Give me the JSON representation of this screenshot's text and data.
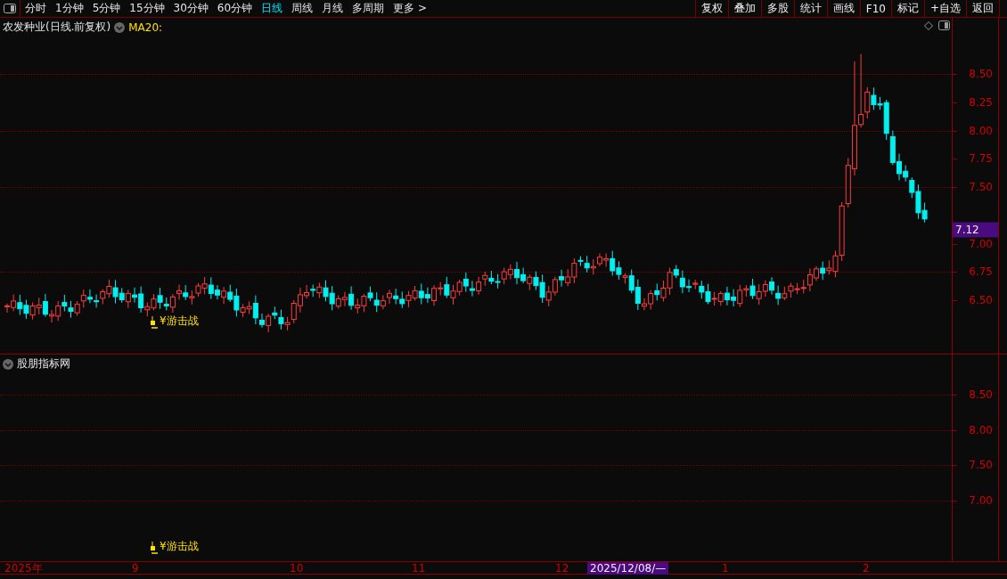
{
  "toolbar": {
    "periods": [
      {
        "label": "分时",
        "selected": false
      },
      {
        "label": "1分钟",
        "selected": false
      },
      {
        "label": "5分钟",
        "selected": false
      },
      {
        "label": "15分钟",
        "selected": false
      },
      {
        "label": "30分钟",
        "selected": false
      },
      {
        "label": "60分钟",
        "selected": false
      },
      {
        "label": "日线",
        "selected": true
      },
      {
        "label": "周线",
        "selected": false
      },
      {
        "label": "月线",
        "selected": false
      },
      {
        "label": "多周期",
        "selected": false
      },
      {
        "label": "更多 >",
        "selected": false
      }
    ],
    "actions": [
      "复权",
      "叠加",
      "多股",
      "统计",
      "画线",
      "F10",
      "标记",
      "+自选",
      "返回"
    ]
  },
  "main_panel": {
    "title": "农发种业(日线.前复权)",
    "indicator": "MA20:",
    "price_ticks": [
      "8.50",
      "8.25",
      "8.00",
      "7.75",
      "7.50",
      "7.00",
      "6.75",
      "6.50"
    ],
    "last_price": "7.12",
    "signal_label": "¥游击战"
  },
  "sub_panel": {
    "title": "股朋指标网",
    "ticks": [
      "8.50",
      "8.00",
      "7.50",
      "7.00"
    ],
    "signal_label": "¥游击战"
  },
  "time_axis": {
    "labels": [
      "2025年",
      "9",
      "10",
      "11",
      "12",
      "1",
      "2"
    ],
    "cursor_label": "2025/12/08/—"
  }
}
